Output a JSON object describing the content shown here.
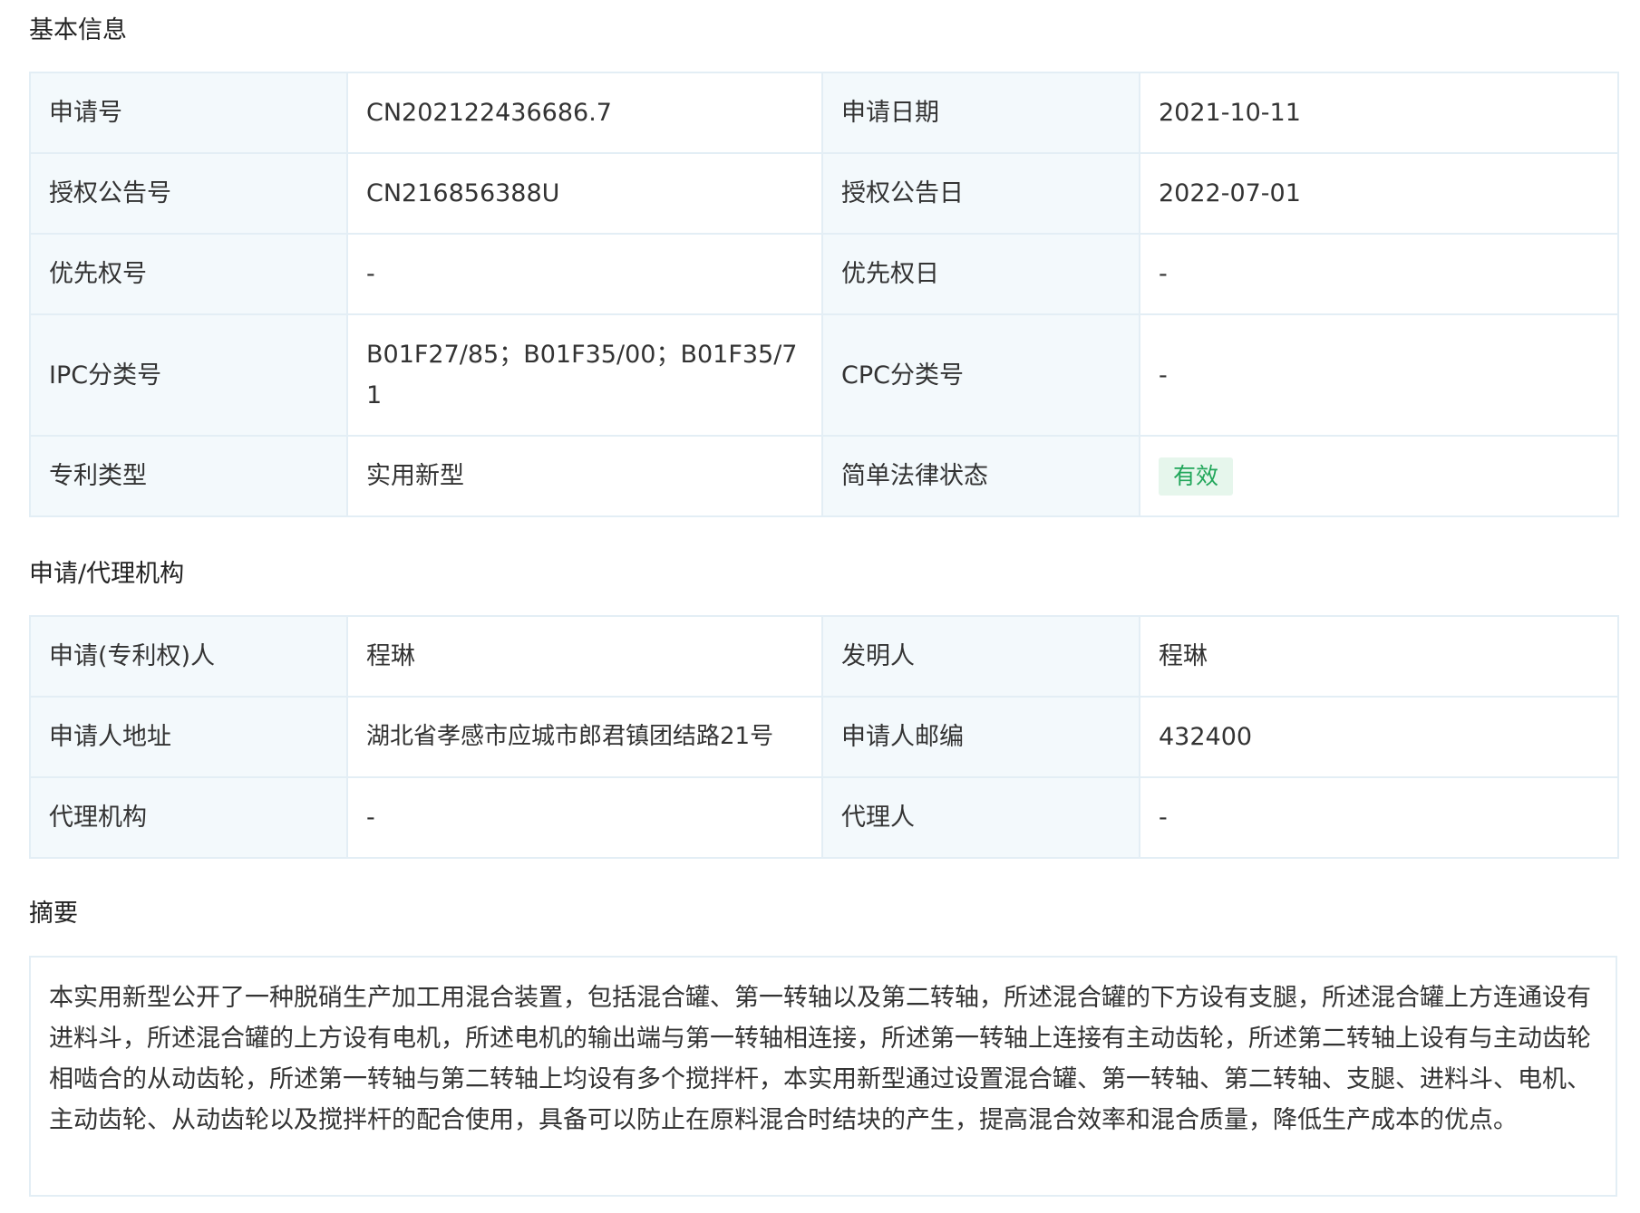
{
  "basic": {
    "title": "基本信息",
    "rows": [
      {
        "l1": "申请号",
        "v1": "CN202122436686.7",
        "l2": "申请日期",
        "v2": "2021-10-11"
      },
      {
        "l1": "授权公告号",
        "v1": "CN216856388U",
        "l2": "授权公告日",
        "v2": "2022-07-01"
      },
      {
        "l1": "优先权号",
        "v1": "-",
        "l2": "优先权日",
        "v2": "-"
      },
      {
        "l1": "IPC分类号",
        "v1": "B01F27/85；B01F35/00；B01F35/71",
        "l2": "CPC分类号",
        "v2": "-"
      },
      {
        "l1": "专利类型",
        "v1": "实用新型",
        "l2": "简单法律状态",
        "v2": "有效"
      }
    ]
  },
  "agency": {
    "title": "申请/代理机构",
    "rows": [
      {
        "l1": "申请(专利权)人",
        "v1": "程琳",
        "l2": "发明人",
        "v2": "程琳"
      },
      {
        "l1": "申请人地址",
        "v1": "湖北省孝感市应城市郎君镇团结路21号",
        "l2": "申请人邮编",
        "v2": "432400"
      },
      {
        "l1": "代理机构",
        "v1": "-",
        "l2": "代理人",
        "v2": "-"
      }
    ]
  },
  "abstract": {
    "title": "摘要",
    "text": "本实用新型公开了一种脱硝生产加工用混合装置，包括混合罐、第一转轴以及第二转轴，所述混合罐的下方设有支腿，所述混合罐上方连通设有进料斗，所述混合罐的上方设有电机，所述电机的输出端与第一转轴相连接，所述第一转轴上连接有主动齿轮，所述第二转轴上设有与主动齿轮相啮合的从动齿轮，所述第一转轴与第二转轴上均设有多个搅拌杆，本实用新型通过设置混合罐、第一转轴、第二转轴、支腿、进料斗、电机、主动齿轮、从动齿轮以及搅拌杆的配合使用，具备可以防止在原料混合时结块的产生，提高混合效率和混合质量，降低生产成本的优点。"
  },
  "colors": {
    "label_bg": "#f3f9fc",
    "border": "#e3eef5",
    "status_bg": "#e6f6ec",
    "status_text": "#21a65a"
  }
}
